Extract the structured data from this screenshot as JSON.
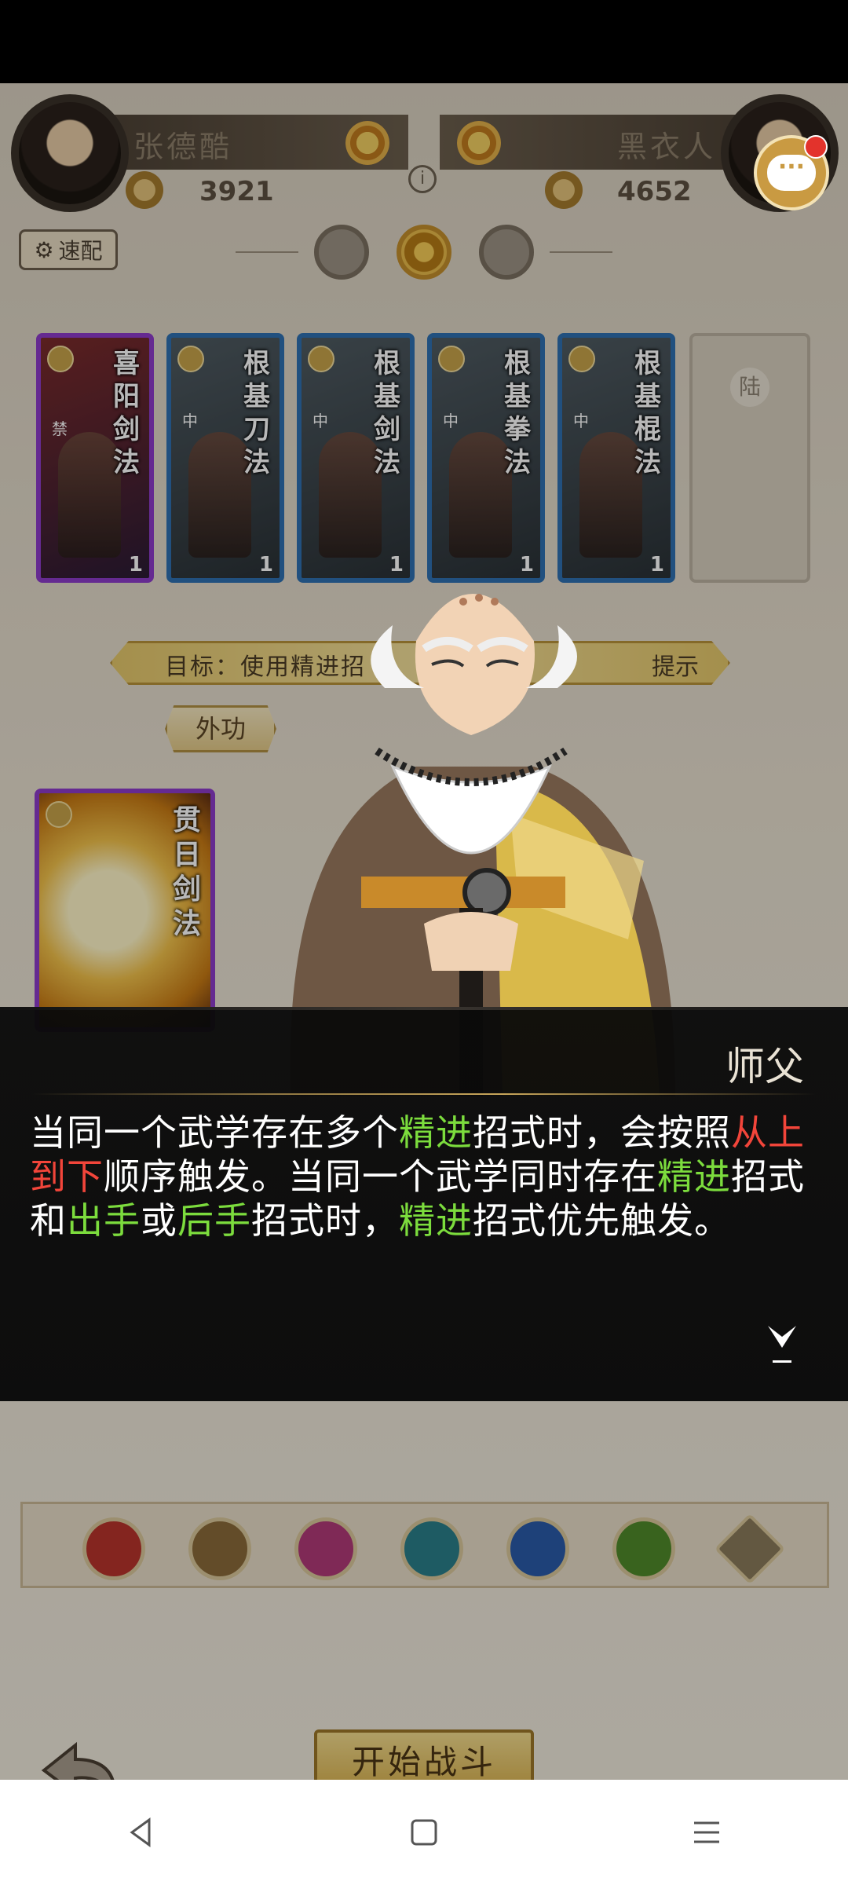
{
  "header": {
    "player_left_name": "张德酷",
    "player_left_power": "3921",
    "player_right_name": "黑衣人",
    "player_right_power": "4652",
    "info_symbol": "i"
  },
  "quick_match_label": "速配",
  "cards": [
    {
      "name": "喜阳剑法",
      "count": "1",
      "tag": "禁",
      "border": "purple"
    },
    {
      "name": "根基刀法",
      "count": "1",
      "tag": "中",
      "border": "blue"
    },
    {
      "name": "根基剑法",
      "count": "1",
      "tag": "中",
      "border": "blue"
    },
    {
      "name": "根基拳法",
      "count": "1",
      "tag": "中",
      "border": "blue"
    },
    {
      "name": "根基棍法",
      "count": "1",
      "tag": "中",
      "border": "blue"
    }
  ],
  "empty_slot_label": "陆",
  "goal_text": "目标：使用精进招",
  "hint_text": "提示",
  "tab_label": "外功",
  "hand_card_name": "贯日剑法",
  "dialog": {
    "speaker": "师父",
    "segments": [
      {
        "text": "当同一个武学存在多个",
        "color": "white"
      },
      {
        "text": "精进",
        "color": "green"
      },
      {
        "text": "招式时，会按照",
        "color": "white"
      },
      {
        "text": "从上到下",
        "color": "red"
      },
      {
        "text": "顺序触发。当同一个武学同时存在",
        "color": "white"
      },
      {
        "text": "精进",
        "color": "green"
      },
      {
        "text": "招式和",
        "color": "white"
      },
      {
        "text": "出手",
        "color": "green"
      },
      {
        "text": "或",
        "color": "white"
      },
      {
        "text": "后手",
        "color": "green"
      },
      {
        "text": "招式时，",
        "color": "white"
      },
      {
        "text": "精进",
        "color": "green"
      },
      {
        "text": "招式优先触发。",
        "color": "white"
      }
    ]
  },
  "skills": [
    {
      "icon": "sword-red-icon",
      "color": "#b8342c"
    },
    {
      "icon": "sword-brown-icon",
      "color": "#8a6a3a"
    },
    {
      "icon": "fist-icon",
      "color": "#b03a78"
    },
    {
      "icon": "fan-icon",
      "color": "#2a7f8a"
    },
    {
      "icon": "yin-yang-icon",
      "color": "#2a5aa8"
    },
    {
      "icon": "staff-green-icon",
      "color": "#4f8a2a"
    },
    {
      "icon": "triangle-icon",
      "color": "#8a7a5a"
    }
  ],
  "start_button_label": "开始战斗",
  "back_label": "返回",
  "colors": {
    "highlight_green": "#7cdc3d",
    "highlight_red": "#f2453a",
    "accent_gold": "#c99a42"
  }
}
